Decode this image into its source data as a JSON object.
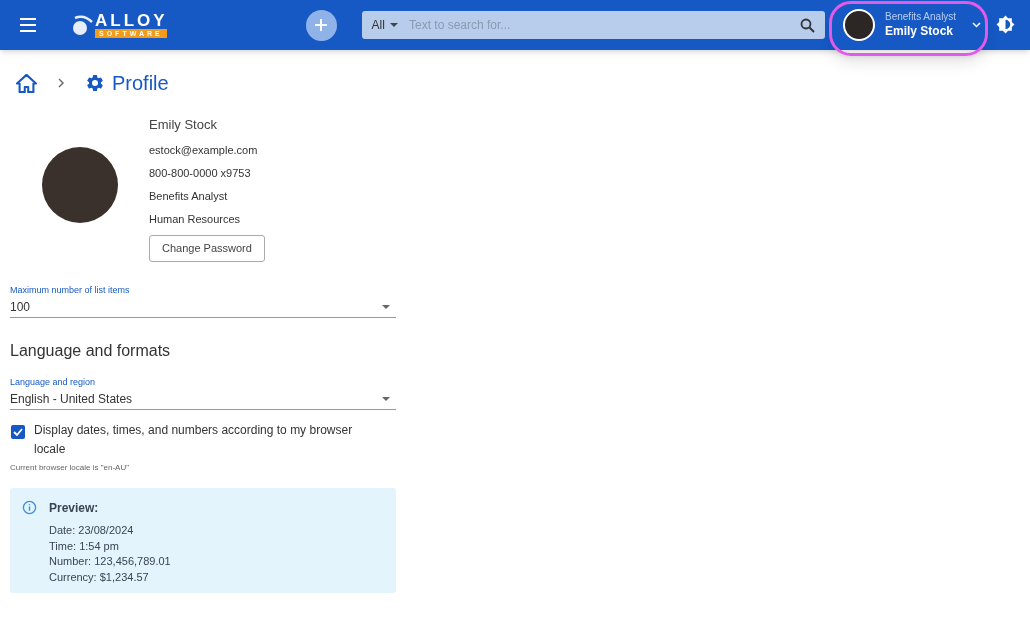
{
  "header": {
    "logo": {
      "word": "ALLOY",
      "tagline": "SOFTWARE"
    },
    "search": {
      "scope": "All",
      "placeholder": "Text to search for..."
    },
    "user": {
      "role": "Benefits Analyst",
      "name": "Emily Stock"
    }
  },
  "breadcrumb": {
    "title": "Profile"
  },
  "profile": {
    "name": "Emily Stock",
    "details": [
      "estock@example.com",
      "800-800-0000 x9753",
      "Benefits Analyst",
      "Human Resources"
    ],
    "button": "Change Password"
  },
  "max_items": {
    "label": "Maximum number of list items",
    "value": "100"
  },
  "section_title": "Language and formats",
  "language": {
    "label": "Language and region",
    "value": "English - United States"
  },
  "browser_locale": {
    "label": "Display dates, times, and numbers according to my browser locale",
    "checked": true,
    "hint": "Current browser locale is \"en-AU\""
  },
  "preview": {
    "title": "Preview:",
    "lines": [
      "Date: 23/08/2024",
      "Time: 1:54 pm",
      "Number: 123,456,789.01",
      "Currency: $1,234.57"
    ]
  }
}
